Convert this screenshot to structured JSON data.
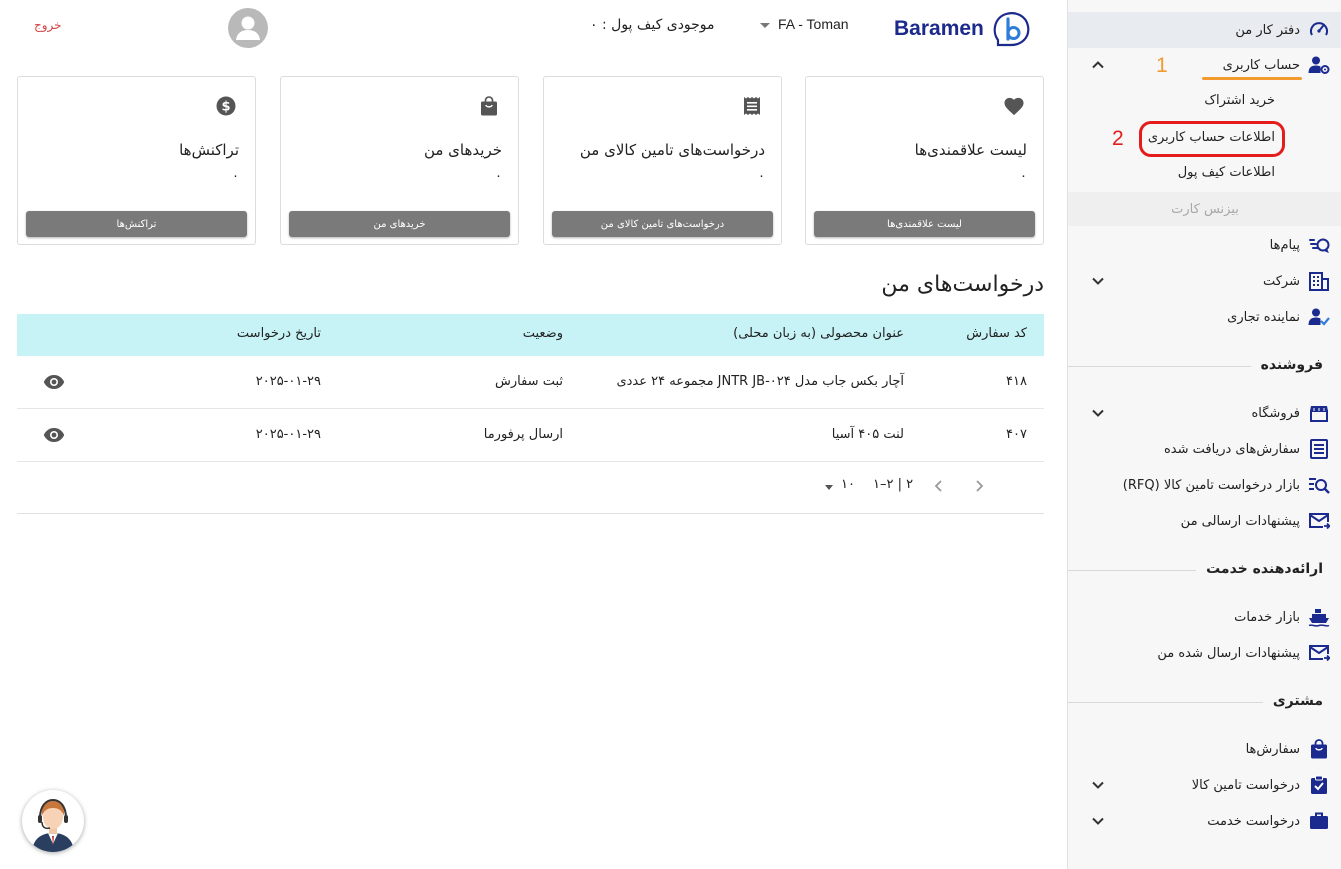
{
  "header": {
    "logo_text": "Baramen",
    "currency": "FA - Toman",
    "wallet_balance": "موجودی کیف پول : ۰",
    "logout": "خروج"
  },
  "cards": [
    {
      "title": "لیست علاقمندی‌ها",
      "count": "۰",
      "button": "لیست علاقمندی‌ها",
      "icon": "heart-icon"
    },
    {
      "title": "درخواست‌های تامین کالای من",
      "count": "۰",
      "button": "درخواست‌های تامین کالای من",
      "icon": "receipt-icon"
    },
    {
      "title": "خریدهای من",
      "count": "۰",
      "button": "خریدهای من",
      "icon": "shopping-bag-icon"
    },
    {
      "title": "تراکنش‌ها",
      "count": "۰",
      "button": "تراکنش‌ها",
      "icon": "dollar-icon"
    }
  ],
  "requests": {
    "title": "درخواست‌های من",
    "columns": [
      "کد سفارش",
      "عنوان محصولی (به زبان محلی)",
      "وضعیت",
      "تاریخ درخواست"
    ],
    "rows": [
      {
        "code": "۴۱۸",
        "product": "آچار بکس جاب مدل JNTR JB-۰۲۴ مجموعه ۲۴ عددی",
        "status": "ثبت سفارش",
        "date": "۲۰۲۵-۰۱-۲۹"
      },
      {
        "code": "۴۰۷",
        "product": "لنت ۴۰۵ آسیا",
        "status": "ارسال پرفورما",
        "date": "۲۰۲۵-۰۱-۲۹"
      }
    ],
    "pagination": {
      "range": "۱–۲ | ۲",
      "per_page": "۱۰"
    }
  },
  "sidebar": {
    "dashboard": "دفتر کار من",
    "account": "حساب کاربری",
    "account_sub": [
      "خرید اشتراک",
      "اطلاعات حساب کاربری",
      "اطلاعات کیف پول"
    ],
    "business_card": "بیزنس کارت",
    "messages": "پیام‌ها",
    "company": "شرکت",
    "trade_rep": "نماینده تجاری",
    "seller_section": "فروشنده",
    "store": "فروشگاه",
    "received_orders": "سفارش‌های دریافت شده",
    "rfq_market": "بازار درخواست تامین کالا (RFQ)",
    "my_sent_offers": "پیشنهادات ارسالی من",
    "provider_section": "ارائه‌دهنده خدمت",
    "service_market": "بازار خدمات",
    "sent_offers": "پیشنهادات ارسال شده من",
    "customer_section": "مشتری",
    "orders": "سفارش‌ها",
    "goods_request": "درخواست تامین کالا",
    "service_request": "درخواست خدمت"
  },
  "annotations": {
    "step1": "1",
    "step2": "2",
    "underline_color": "#f39a2e",
    "circle_color": "#e41c1c"
  },
  "colors": {
    "brand": "#1c2a8c",
    "table_header": "#c7f3f6",
    "button": "#7a7a7a",
    "logout": "#d34343"
  }
}
